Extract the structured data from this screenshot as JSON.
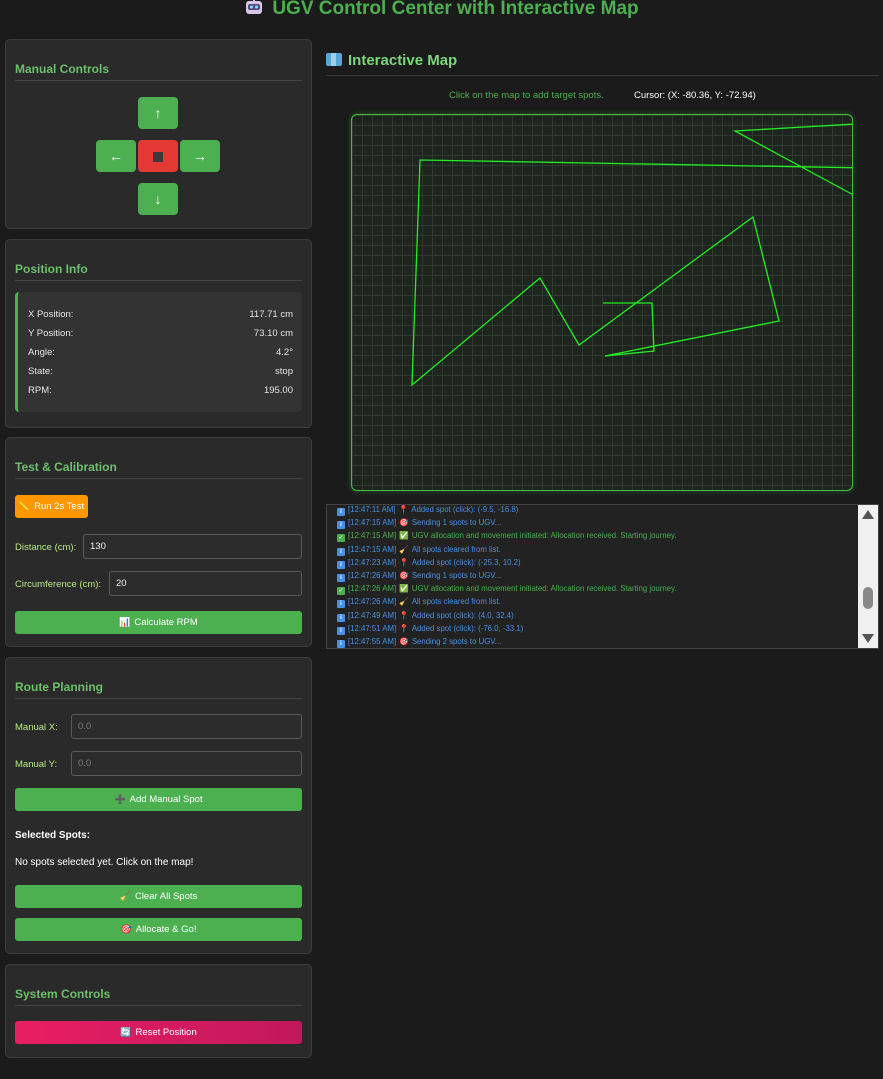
{
  "app": {
    "title": "UGV Control Center with Interactive Map"
  },
  "manual_controls": {
    "title": "Manual Controls",
    "up": "↑",
    "left": "←",
    "right": "→",
    "down": "↓"
  },
  "position_info": {
    "title": "Position Info",
    "rows": [
      {
        "label": "X Position:",
        "value": "117.71 cm"
      },
      {
        "label": "Y Position:",
        "value": "73.10 cm"
      },
      {
        "label": "Angle:",
        "value": "4.2°"
      },
      {
        "label": "State:",
        "value": "stop"
      },
      {
        "label": "RPM:",
        "value": "195.00"
      }
    ]
  },
  "calibration": {
    "title": "Test & Calibration",
    "run_test_label": "Run 2s Test",
    "distance_label": "Distance (cm):",
    "distance_value": "130",
    "circumference_label": "Circumference (cm):",
    "circumference_value": "20",
    "calculate_label": "Calculate RPM"
  },
  "route_planning": {
    "title": "Route Planning",
    "manual_x_label": "Manual X:",
    "manual_x_placeholder": "0.0",
    "manual_y_label": "Manual Y:",
    "manual_y_placeholder": "0.0",
    "add_spot_label": "Add Manual Spot",
    "selected_spots_title": "Selected Spots:",
    "selected_spots_empty": "No spots selected yet. Click on the map!",
    "clear_label": "Clear All Spots",
    "allocate_label": "Allocate & Go!"
  },
  "system_controls": {
    "title": "System Controls",
    "reset_label": "Reset Position"
  },
  "map": {
    "title": "Interactive Map",
    "hint": "Click on the map to add target spots.",
    "cursor": "Cursor: (X: -80.36, Y: -72.94)",
    "path_color": "#22ee22",
    "grid_color": "#2d3a2d"
  },
  "log": [
    {
      "type": "info",
      "time": "[12:47:11 AM]",
      "icon": "pin-icon",
      "text": "Added spot (click): (-9.5, -16.8)"
    },
    {
      "type": "info",
      "time": "[12:47:15 AM]",
      "icon": "target-icon",
      "text": "Sending 1 spots to UGV..."
    },
    {
      "type": "success",
      "time": "[12:47:15 AM]",
      "icon": "check-icon",
      "text": "UGV allocation and movement initiated: Allocation received. Starting journey."
    },
    {
      "type": "info",
      "time": "[12:47:15 AM]",
      "icon": "broom-icon",
      "text": "All spots cleared from list."
    },
    {
      "type": "info",
      "time": "[12:47:23 AM]",
      "icon": "pin-icon",
      "text": "Added spot (click): (-25.3, 10.2)"
    },
    {
      "type": "info",
      "time": "[12:47:26 AM]",
      "icon": "target-icon",
      "text": "Sending 1 spots to UGV..."
    },
    {
      "type": "success",
      "time": "[12:47:26 AM]",
      "icon": "check-icon",
      "text": "UGV allocation and movement initiated: Allocation received. Starting journey."
    },
    {
      "type": "info",
      "time": "[12:47:26 AM]",
      "icon": "broom-icon",
      "text": "All spots cleared from list."
    },
    {
      "type": "info",
      "time": "[12:47:49 AM]",
      "icon": "pin-icon",
      "text": "Added spot (click): (4.0, 32.4)"
    },
    {
      "type": "info",
      "time": "[12:47:51 AM]",
      "icon": "pin-icon",
      "text": "Added spot (click): (-76.0, -33.1)"
    },
    {
      "type": "info",
      "time": "[12:47:55 AM]",
      "icon": "target-icon",
      "text": "Sending 2 spots to UGV..."
    }
  ]
}
